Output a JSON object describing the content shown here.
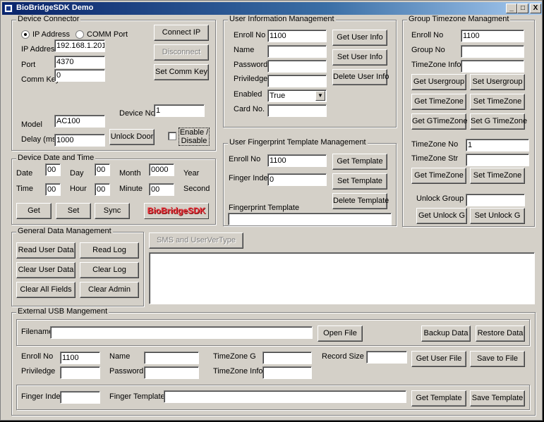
{
  "window": {
    "title": "BioBridgeSDK Demo",
    "min": "_",
    "max": "□",
    "close": "X"
  },
  "device_connector": {
    "title": "Device Connector",
    "radio_ip": "IP Address",
    "radio_comm": "COMM Port",
    "ip_label": "IP Address",
    "ip_value": "192.168.1.201",
    "port_label": "Port",
    "port_value": "4370",
    "commkey_label": "Comm Key",
    "commkey_value": "0",
    "connect_ip": "Connect IP",
    "disconnect": "Disconnect",
    "set_comm_key": "Set Comm Key",
    "model_label": "Model",
    "model_value": "AC100",
    "device_no_label": "Device No",
    "device_no_value": "1",
    "delay_label": "Delay (ms)",
    "delay_value": "1000",
    "unlock_door": "Unlock Door",
    "enable_disable": "Enable / Disable"
  },
  "date_time": {
    "title": "Device Date and Time",
    "date_label": "Date",
    "date_value": "00",
    "day_label": "Day",
    "day_value": "00",
    "month_label": "Month",
    "month_value": "0000",
    "year_label": "Year",
    "time_label": "Time",
    "time_value": "00",
    "hour_label": "Hour",
    "hour_value": "00",
    "minute_label": "Minute",
    "minute_value": "00",
    "second_label": "Second",
    "get": "Get",
    "set": "Set",
    "sync": "Sync",
    "logo": "BioBridgeSDK"
  },
  "user_info": {
    "title": "User Information Management",
    "enroll_label": "Enroll No",
    "enroll_value": "1100",
    "name_label": "Name",
    "password_label": "Password",
    "privilege_label": "Priviledge",
    "enabled_label": "Enabled",
    "enabled_value": "True",
    "card_label": "Card No.",
    "get_user_info": "Get User Info",
    "set_user_info": "Set User Info",
    "delete_user_info": "Delete User Info"
  },
  "fingerprint": {
    "title": "User Fingerprint Template Management",
    "enroll_label": "Enroll No",
    "enroll_value": "1100",
    "finger_index_label": "Finger Index",
    "finger_index_value": "0",
    "template_label": "Fingerprint Template",
    "get_template": "Get Template",
    "set_template": "Set Template",
    "delete_template": "Delete Template"
  },
  "group_tz": {
    "title": "Group Timezone Managment",
    "enroll_label": "Enroll No",
    "enroll_value": "1100",
    "group_label": "Group No",
    "tzinfo_label": "TimeZone Info",
    "get_usergroup": "Get Usergroup",
    "set_usergroup": "Set Usergroup",
    "get_timezone": "Get TimeZone",
    "set_timezone": "Set TimeZone",
    "get_gtimezone": "Get GTimeZone",
    "set_gtimezone": "Set G TimeZone",
    "tzno_label": "TimeZone No",
    "tzno_value": "1",
    "tzstr_label": "TimeZone Str",
    "get_timezone2": "Get TimeZone",
    "set_timezone2": "Set TimeZone",
    "unlock_group_label": "Unlock Group",
    "get_unlock_g": "Get Unlock G",
    "set_unlock_g": "Set Unlock G"
  },
  "general": {
    "title": "General Data Management",
    "read_user_data": "Read User Data",
    "read_log": "Read Log",
    "clear_user_data": "Clear User Data",
    "clear_log": "Clear Log",
    "clear_all_fields": "Clear All Fields",
    "clear_admin": "Clear Admin",
    "sms": "SMS and UserVerType"
  },
  "usb": {
    "title": "External USB Mangement",
    "filename_label": "Filename",
    "open_file": "Open File",
    "backup_data": "Backup Data",
    "restore_data": "Restore Data",
    "enroll_label": "Enroll No",
    "enroll_value": "1100",
    "name_label": "Name",
    "tzg_label": "TimeZone G",
    "record_size_label": "Record Size",
    "get_user_file": "Get User File",
    "save_to_file": "Save to File",
    "privilege_label": "Priviledge",
    "password_label": "Password",
    "tzinfo_label": "TimeZone Info",
    "finger_index_label": "Finger Index",
    "finger_template_label": "Finger Template",
    "get_template": "Get Template",
    "save_template": "Save Template"
  }
}
